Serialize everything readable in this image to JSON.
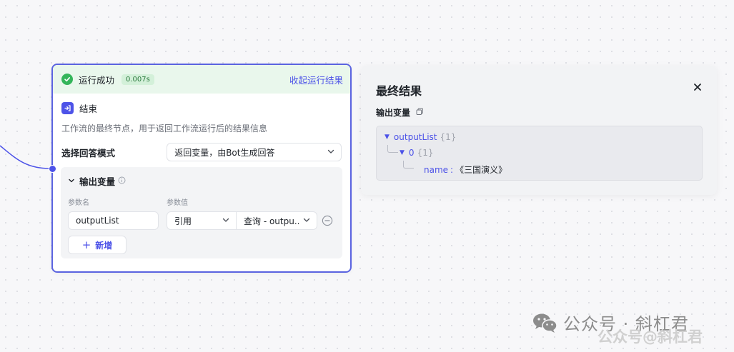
{
  "run_status": {
    "label": "运行成功",
    "duration": "0.007s",
    "collapse_label": "收起运行结果"
  },
  "node": {
    "title": "结束",
    "description": "工作流的最终节点，用于返回工作流运行后的结果信息",
    "mode_label": "选择回答模式",
    "mode_value": "返回变量，由Bot生成回答",
    "output_section": "输出变量",
    "col_name": "参数名",
    "col_value": "参数值",
    "var_name": "outputList",
    "var_type": "引用",
    "var_ref": "查询 - outpu..",
    "add_label": "新增"
  },
  "result_panel": {
    "title": "最终结果",
    "vars_label": "输出变量",
    "json": {
      "root_key": "outputList",
      "root_count": "{1}",
      "item_key": "0",
      "item_count": "{1}",
      "field_key": "name",
      "field_value": "《三国演义》"
    }
  },
  "watermark": {
    "main": "公众号 · 斜杠君",
    "sub": "公众号@斜杠君"
  },
  "colors": {
    "accent": "#4d53e8",
    "success": "#34b55a",
    "success_bg": "#e9f7ec"
  }
}
